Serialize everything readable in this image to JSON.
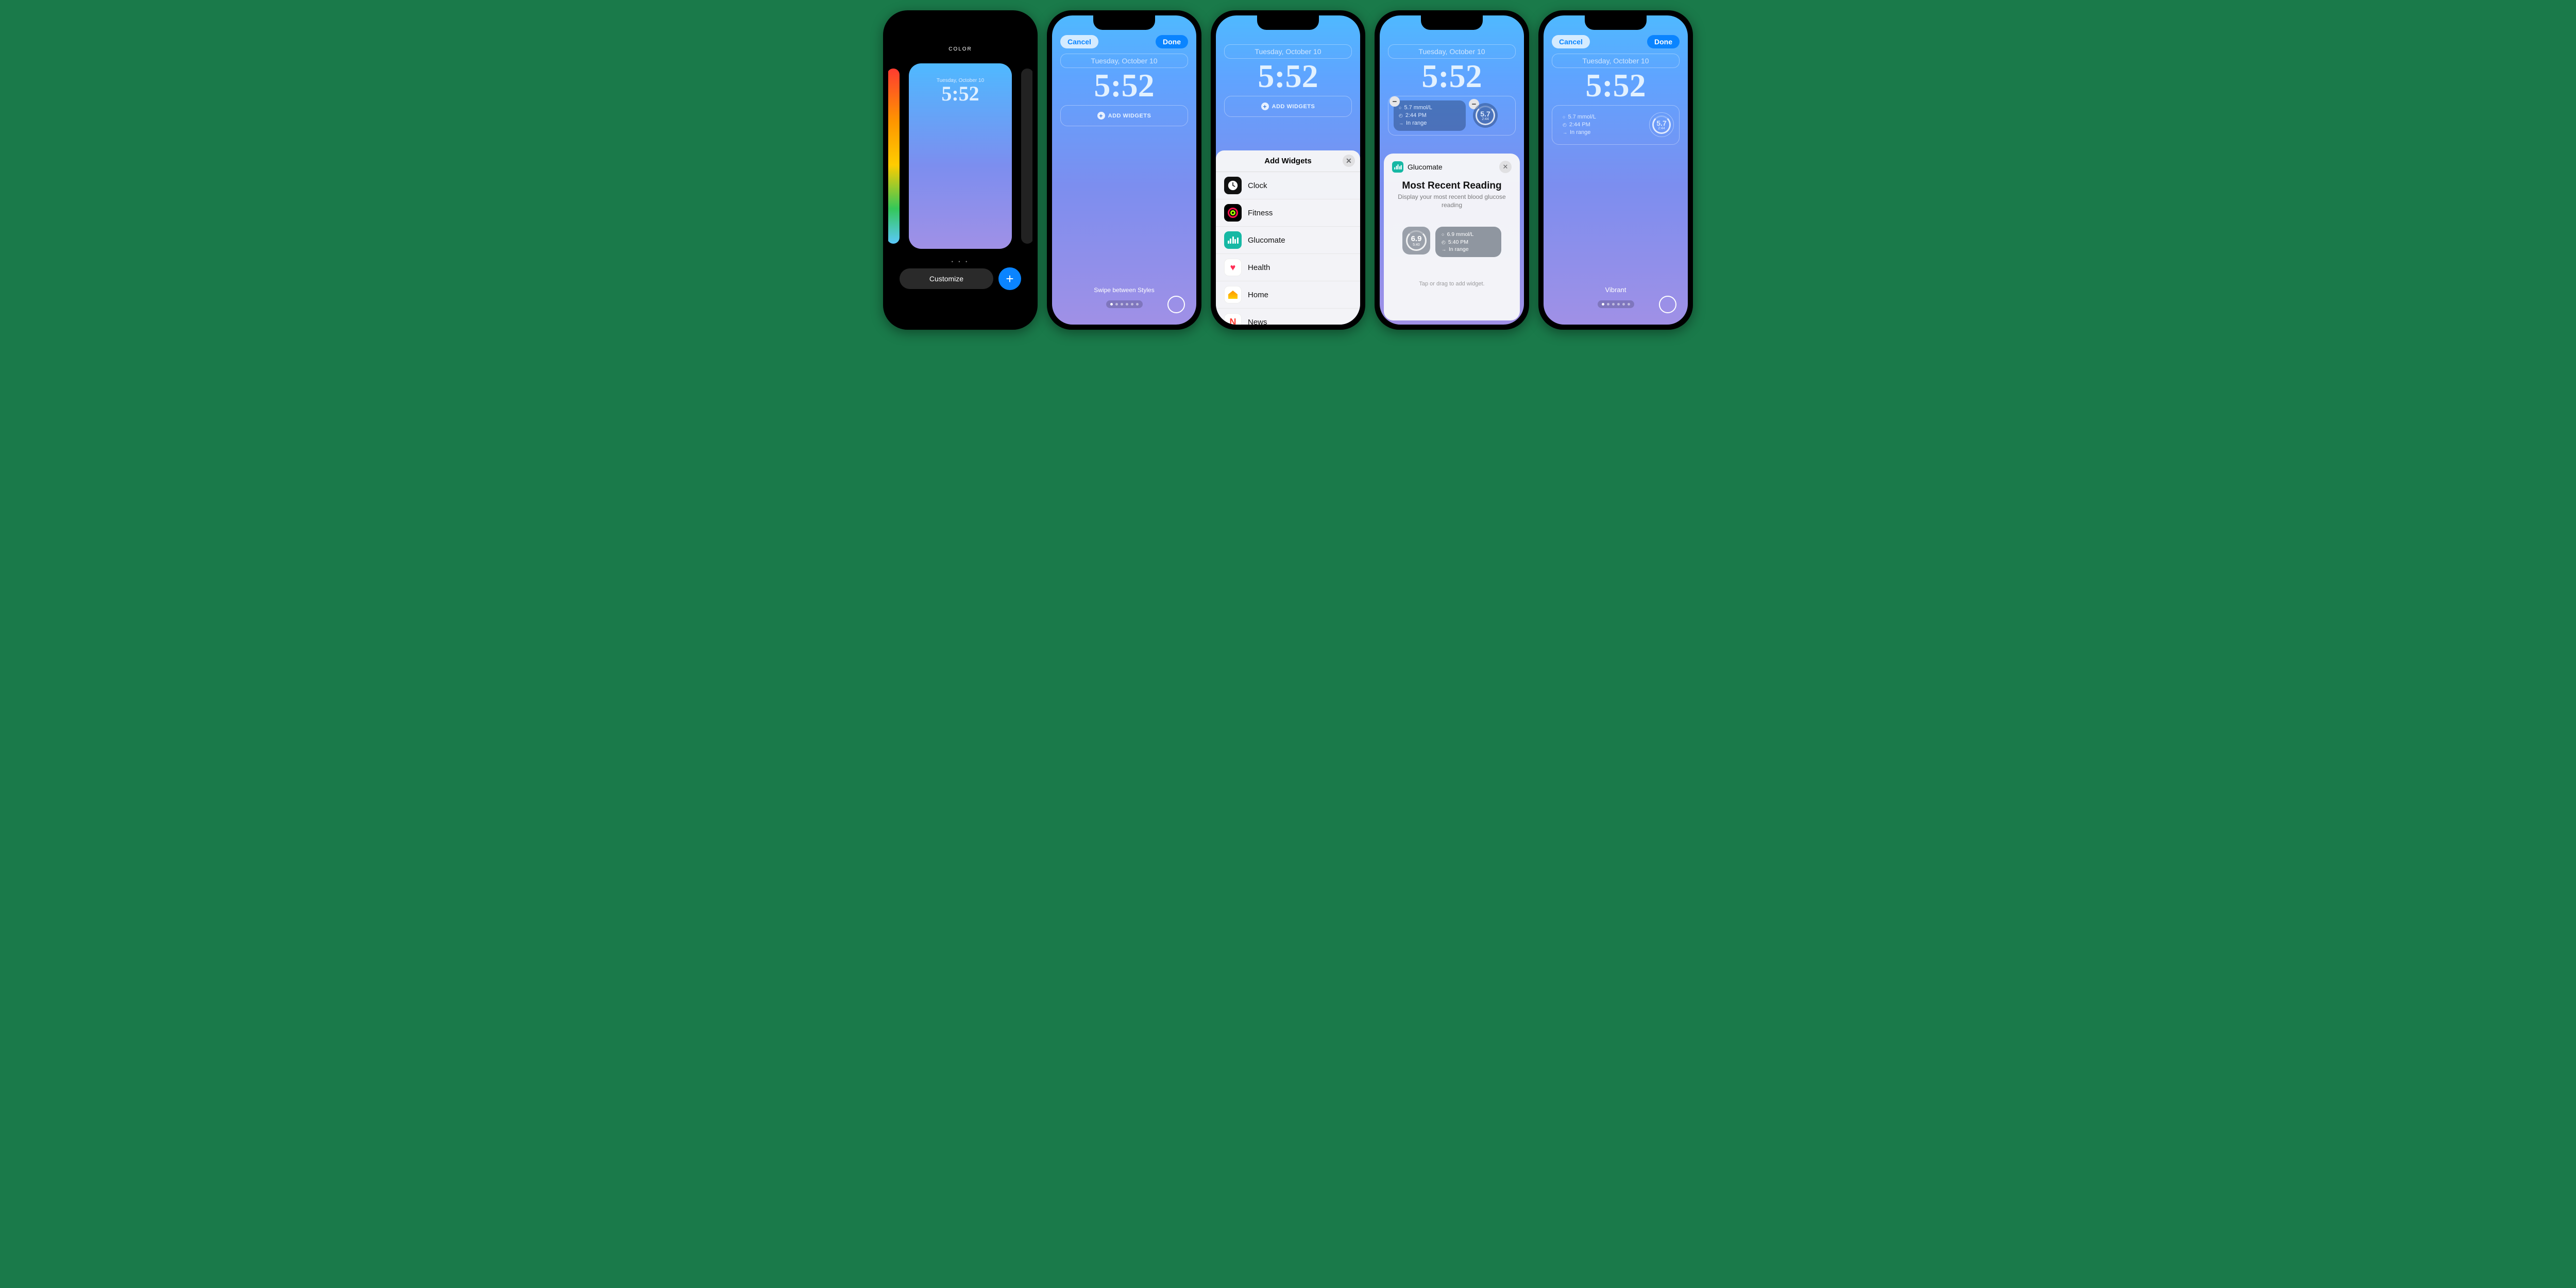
{
  "date": "Tuesday, October 10",
  "time": "5:52",
  "phone1": {
    "heading": "COLOR",
    "dots": "• • •",
    "customize": "Customize",
    "plus": "+"
  },
  "buttons": {
    "cancel": "Cancel",
    "done": "Done"
  },
  "add_widgets": "ADD WIDGETS",
  "swipe": "Swipe between Styles",
  "sheet": {
    "title": "Add Widgets",
    "items": [
      "Clock",
      "Fitness",
      "Glucomate",
      "Health",
      "Home",
      "News"
    ]
  },
  "glucomate": {
    "app": "Glucomate",
    "title": "Most Recent Reading",
    "subtitle": "Display your most recent blood glucose reading",
    "hint": "Tap or drag to add widget.",
    "preview": {
      "value": "6.9",
      "unit": "mmol/L",
      "time": "5:40 PM",
      "status": "In range",
      "combined": "6.9 mmol/L",
      "short_time": "5:40"
    }
  },
  "placed": {
    "value": "5.7",
    "unit": "mmol/L",
    "combined": "5.7 mmol/L",
    "time": "2:44 PM",
    "status": "In range",
    "short_time": "2:44"
  },
  "vibrant": "Vibrant"
}
